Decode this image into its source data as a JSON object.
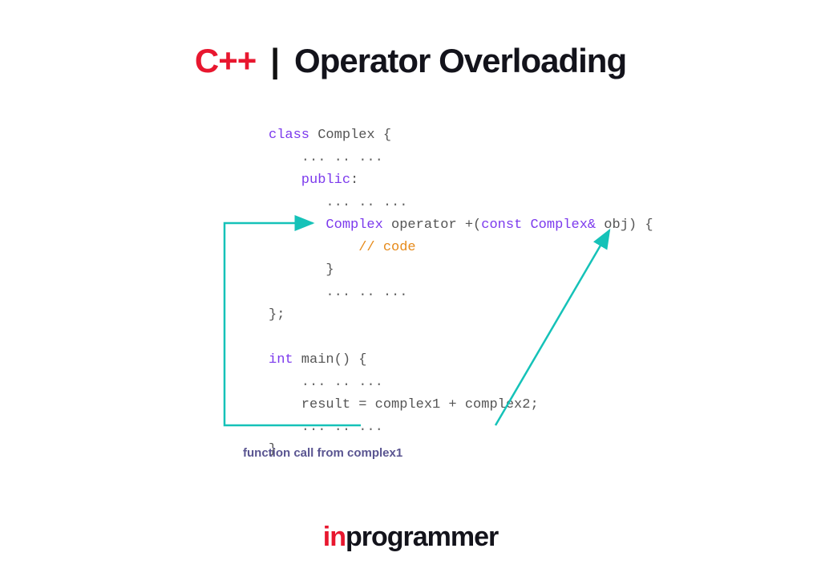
{
  "header": {
    "lang": "C++",
    "divider": "|",
    "title": "Operator Overloading"
  },
  "code": {
    "kw_class": "class",
    "classname": " Complex {",
    "dots1": "    ... .. ...",
    "kw_public": "    public",
    "colon": ":",
    "dots2": "       ... .. ...",
    "ret_type": "       Complex",
    "op_kw": " operator",
    "op_sym": " +(",
    "kw_const": "const",
    "amp": " Complex&",
    "arg": " obj) {",
    "comment": "           // code",
    "brace_close1": "       }",
    "dots3": "       ... .. ...",
    "brace_close2": "};",
    "kw_int": "int",
    "main": " main() {",
    "dots4": "    ... .. ...",
    "result": "    result = complex1 + complex2;",
    "dots5": "    ... .. ...",
    "brace_close3": "}"
  },
  "caption": "function call from complex1",
  "footer": {
    "in": "in",
    "rest": "programmer"
  },
  "colors": {
    "teal": "#15c2b8"
  }
}
